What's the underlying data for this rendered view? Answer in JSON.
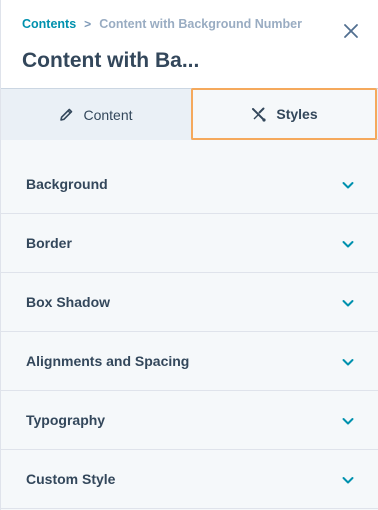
{
  "breadcrumb": {
    "root": "Contents",
    "separator": ">",
    "current": "Content with Background Number"
  },
  "title": "Content with Ba...",
  "tabs": [
    {
      "label": "Content",
      "icon": "pencil-icon",
      "active": false
    },
    {
      "label": "Styles",
      "icon": "styles-icon",
      "active": true
    }
  ],
  "sections": [
    {
      "label": "Background"
    },
    {
      "label": "Border"
    },
    {
      "label": "Box Shadow"
    },
    {
      "label": "Alignments and Spacing"
    },
    {
      "label": "Typography"
    },
    {
      "label": "Custom Style"
    }
  ],
  "colors": {
    "accent": "#0091ae",
    "highlight": "#f5a95c",
    "text": "#33475b"
  }
}
